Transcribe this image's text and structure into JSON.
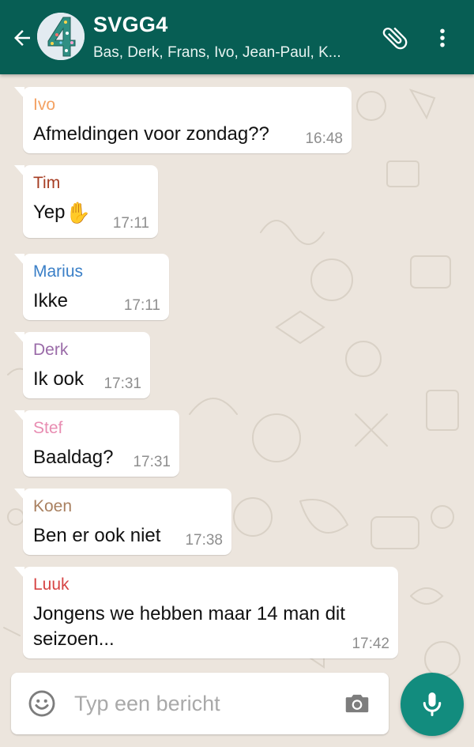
{
  "header": {
    "title": "SVGG4",
    "subtitle": "Bas, Derk, Frans, Ivo, Jean-Paul, K...",
    "avatar_text": "4",
    "icons": [
      "back-arrow-icon",
      "paperclip-icon",
      "more-vertical-icon"
    ]
  },
  "messages": [
    {
      "sender": "Ivo",
      "text": "Afmeldingen voor zondag??",
      "time": "16:48",
      "color": "#F4A263"
    },
    {
      "sender": "Tim",
      "text": "Yep",
      "emoji": "✋",
      "time": "17:11",
      "color": "#A63D23"
    },
    {
      "sender": "Marius",
      "text": "Ikke",
      "time": "17:11",
      "color": "#3A7FC7"
    },
    {
      "sender": "Derk",
      "text": "Ik ook",
      "time": "17:31",
      "color": "#9A6BA8"
    },
    {
      "sender": "Stef",
      "text": "Baaldag?",
      "time": "17:31",
      "color": "#E88DB2"
    },
    {
      "sender": "Koen",
      "text": "Ben er ook niet",
      "time": "17:38",
      "color": "#A98060"
    },
    {
      "sender": "Luuk",
      "text": "Jongens we hebben maar 14 man dit seizoen...",
      "time": "17:42",
      "color": "#D64545"
    }
  ],
  "composer": {
    "placeholder": "Typ een bericht",
    "icons": [
      "emoji-icon",
      "camera-icon",
      "microphone-icon"
    ]
  },
  "colors": {
    "header": "#075E54",
    "wallpaper": "#ECE5DD",
    "mic_button": "#128C7E"
  }
}
